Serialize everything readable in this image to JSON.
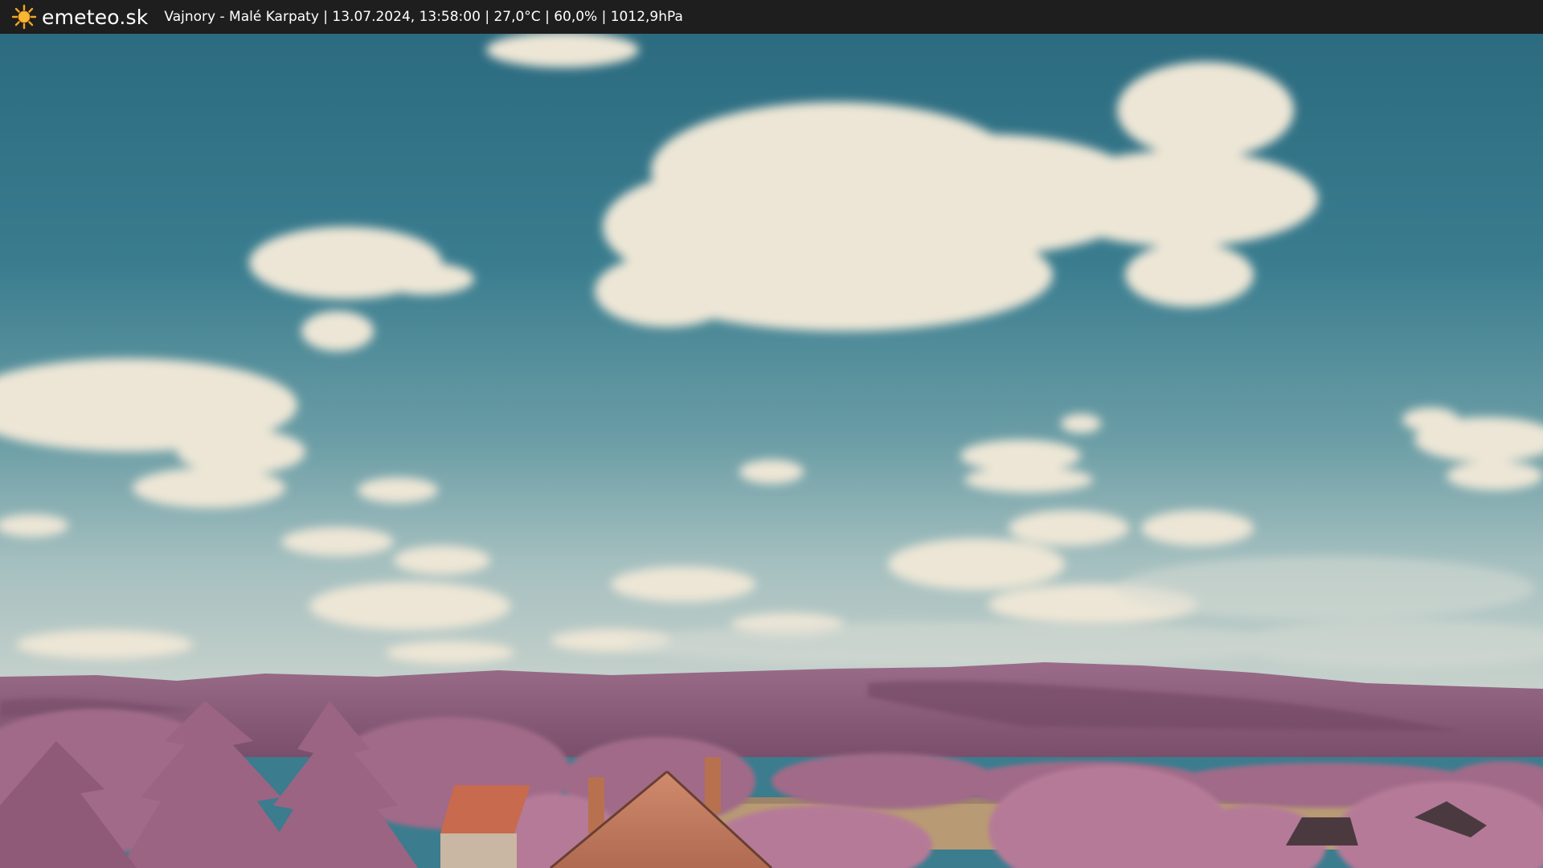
{
  "overlay": {
    "brand": "emeteo.sk",
    "caption": "Vajnory - Malé Karpaty | 13.07.2024, 13:58:00 | 27,0°C | 60,0% | 1012,9hPa",
    "icon": "sun-icon"
  },
  "colors": {
    "bar": "#1e1e1e",
    "brand_text": "#ffffff",
    "sun": "#f5a623",
    "sky_top": "#2f7186",
    "sky_horizon": "#b6c8c6",
    "foliage": "#a8708e",
    "hills": "#8e5f7c",
    "roof": "#c86a4e",
    "field": "#b89a74",
    "cloud": "#ede6d6"
  }
}
